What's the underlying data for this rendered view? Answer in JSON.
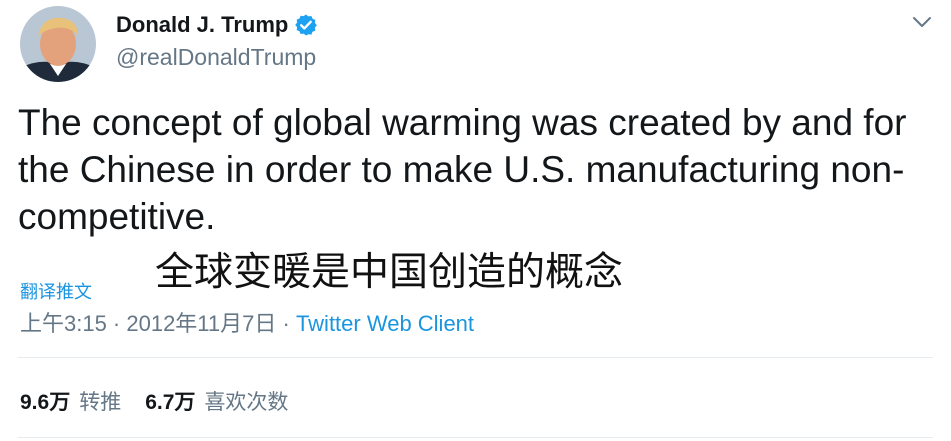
{
  "author": {
    "display_name": "Donald J. Trump",
    "handle": "@realDonaldTrump",
    "verified": true
  },
  "tweet": {
    "text": "The concept of global warming was created by and for the Chinese in order to make U.S. manufacturing non-competitive.",
    "overlay_caption": "全球变暖是中国创造的概念",
    "translate_label": "翻译推文",
    "timestamp": "上午3:15 · 2012年11月7日 · ",
    "client": "Twitter Web Client"
  },
  "stats": {
    "retweets_count": "9.6万",
    "retweets_label": "转推",
    "likes_count": "6.7万",
    "likes_label": "喜欢次数"
  },
  "colors": {
    "link_blue": "#1b95e0",
    "verified_blue": "#1da1f2",
    "secondary_text": "#657786"
  },
  "icons": [
    "verified-badge-icon",
    "chevron-down-icon"
  ]
}
